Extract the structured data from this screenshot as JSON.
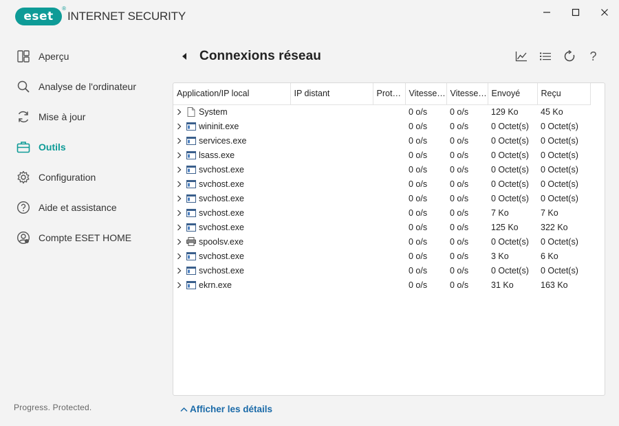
{
  "app": {
    "logo_text": "eset",
    "product_name": "INTERNET SECURITY",
    "brand_color": "#0e9b97"
  },
  "window_controls": [
    "minimize-icon",
    "maximize-icon",
    "close-icon"
  ],
  "sidebar": {
    "items": [
      {
        "label": "Aperçu",
        "icon": "overview-icon",
        "active": false
      },
      {
        "label": "Analyse de l'ordinateur",
        "icon": "search-icon",
        "active": false
      },
      {
        "label": "Mise à jour",
        "icon": "refresh-icon",
        "active": false
      },
      {
        "label": "Outils",
        "icon": "toolbox-icon",
        "active": true
      },
      {
        "label": "Configuration",
        "icon": "gear-icon",
        "active": false
      },
      {
        "label": "Aide et assistance",
        "icon": "help-icon",
        "active": false
      },
      {
        "label": "Compte ESET HOME",
        "icon": "account-icon",
        "active": false
      }
    ],
    "tagline": "Progress. Protected."
  },
  "header": {
    "title": "Connexions réseau",
    "tools": [
      "chart-icon",
      "list-icon",
      "refresh-icon",
      "help-icon"
    ],
    "help_glyph": "?"
  },
  "table": {
    "columns": [
      "Application/IP local",
      "IP distant",
      "Protocole",
      "Vitesse d'envoi",
      "Vitesse de réception",
      "Envoyé",
      "Reçu"
    ],
    "rows": [
      {
        "app": "System",
        "icon": "document-icon",
        "ip": "",
        "proto": "",
        "up": "0 o/s",
        "down": "0 o/s",
        "sent": "129 Ko",
        "recv": "45 Ko"
      },
      {
        "app": "wininit.exe",
        "icon": "window-icon",
        "ip": "",
        "proto": "",
        "up": "0 o/s",
        "down": "0 o/s",
        "sent": "0 Octet(s)",
        "recv": "0 Octet(s)"
      },
      {
        "app": "services.exe",
        "icon": "window-icon",
        "ip": "",
        "proto": "",
        "up": "0 o/s",
        "down": "0 o/s",
        "sent": "0 Octet(s)",
        "recv": "0 Octet(s)"
      },
      {
        "app": "lsass.exe",
        "icon": "window-icon",
        "ip": "",
        "proto": "",
        "up": "0 o/s",
        "down": "0 o/s",
        "sent": "0 Octet(s)",
        "recv": "0 Octet(s)"
      },
      {
        "app": "svchost.exe",
        "icon": "window-icon",
        "ip": "",
        "proto": "",
        "up": "0 o/s",
        "down": "0 o/s",
        "sent": "0 Octet(s)",
        "recv": "0 Octet(s)"
      },
      {
        "app": "svchost.exe",
        "icon": "window-icon",
        "ip": "",
        "proto": "",
        "up": "0 o/s",
        "down": "0 o/s",
        "sent": "0 Octet(s)",
        "recv": "0 Octet(s)"
      },
      {
        "app": "svchost.exe",
        "icon": "window-icon",
        "ip": "",
        "proto": "",
        "up": "0 o/s",
        "down": "0 o/s",
        "sent": "0 Octet(s)",
        "recv": "0 Octet(s)"
      },
      {
        "app": "svchost.exe",
        "icon": "window-icon",
        "ip": "",
        "proto": "",
        "up": "0 o/s",
        "down": "0 o/s",
        "sent": "7 Ko",
        "recv": "7 Ko"
      },
      {
        "app": "svchost.exe",
        "icon": "window-icon",
        "ip": "",
        "proto": "",
        "up": "0 o/s",
        "down": "0 o/s",
        "sent": "125 Ko",
        "recv": "322 Ko"
      },
      {
        "app": "spoolsv.exe",
        "icon": "printer-icon",
        "ip": "",
        "proto": "",
        "up": "0 o/s",
        "down": "0 o/s",
        "sent": "0 Octet(s)",
        "recv": "0 Octet(s)"
      },
      {
        "app": "svchost.exe",
        "icon": "window-icon",
        "ip": "",
        "proto": "",
        "up": "0 o/s",
        "down": "0 o/s",
        "sent": "3 Ko",
        "recv": "6 Ko"
      },
      {
        "app": "svchost.exe",
        "icon": "window-icon",
        "ip": "",
        "proto": "",
        "up": "0 o/s",
        "down": "0 o/s",
        "sent": "0 Octet(s)",
        "recv": "0 Octet(s)"
      },
      {
        "app": "ekrn.exe",
        "icon": "window-icon",
        "ip": "",
        "proto": "",
        "up": "0 o/s",
        "down": "0 o/s",
        "sent": "31 Ko",
        "recv": "163 Ko"
      }
    ]
  },
  "footer": {
    "details_link": "Afficher les détails"
  }
}
